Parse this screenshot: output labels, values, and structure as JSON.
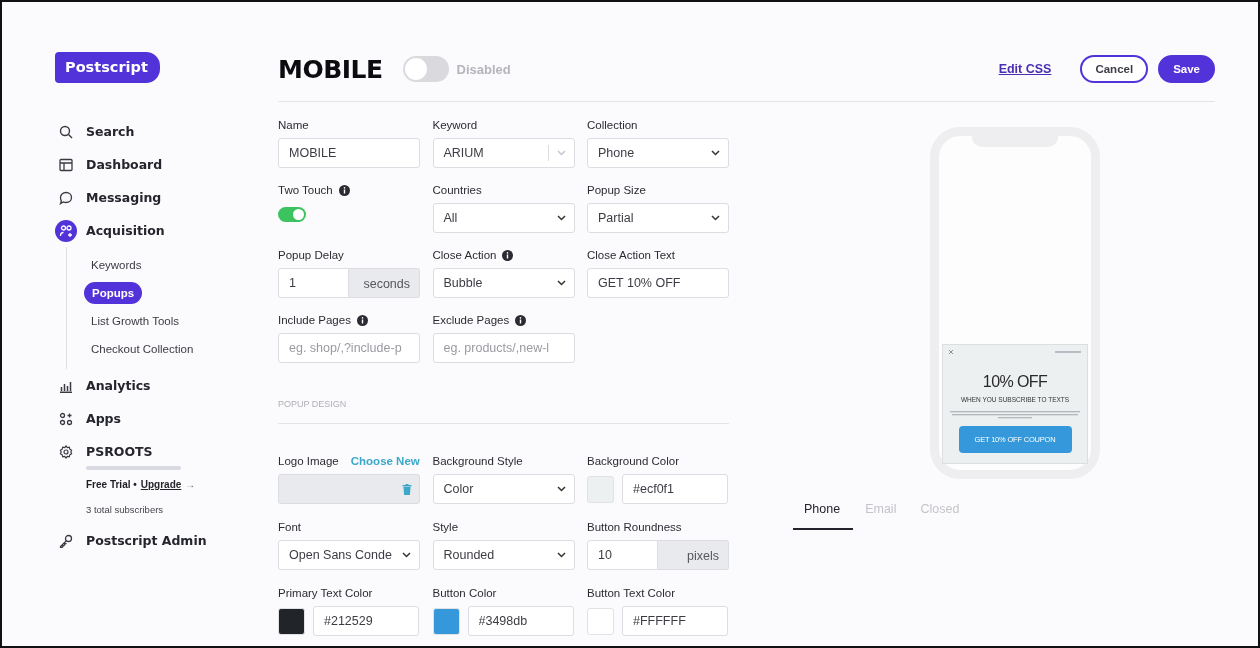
{
  "logo": "Postscript",
  "nav": [
    {
      "label": "Search",
      "selected": false
    },
    {
      "label": "Dashboard",
      "selected": false
    },
    {
      "label": "Messaging",
      "selected": false
    },
    {
      "label": "Acquisition",
      "selected": true,
      "children": [
        {
          "label": "Keywords",
          "selected": false
        },
        {
          "label": "Popups",
          "selected": true
        },
        {
          "label": "List Growth Tools",
          "selected": false
        },
        {
          "label": "Checkout Collection",
          "selected": false
        }
      ]
    },
    {
      "label": "Analytics",
      "selected": false
    },
    {
      "label": "Apps",
      "selected": false
    },
    {
      "label": "PSROOTS",
      "selected": false
    }
  ],
  "account": {
    "plan": "Free Trial •",
    "upgrade": "Upgrade",
    "arrow": "→",
    "subscribers": "3 total subscribers"
  },
  "admin": "Postscript Admin",
  "header": {
    "title": "MOBILE",
    "enabled": false,
    "status": "Disabled",
    "edit_css": "Edit CSS",
    "buttons": [
      {
        "label": "Cancel",
        "kind": "secondary"
      },
      {
        "label": "Save",
        "kind": "primary"
      }
    ]
  },
  "general": [
    {
      "label": "Name",
      "kind": "text",
      "value": "MOBILE"
    },
    {
      "label": "Keyword",
      "kind": "combo",
      "value": "ARIUM"
    },
    {
      "label": "Collection",
      "kind": "select",
      "value": "Phone"
    },
    {
      "label": "Two Touch",
      "info": true,
      "kind": "toggle",
      "on": true
    },
    {
      "label": "Countries",
      "kind": "select",
      "value": "All"
    },
    {
      "label": "Popup Size",
      "kind": "select",
      "value": "Partial"
    },
    {
      "label": "Popup Delay",
      "kind": "unit",
      "value": "1",
      "unit": "seconds"
    },
    {
      "label": "Close Action",
      "info": true,
      "kind": "select",
      "value": "Bubble"
    },
    {
      "label": "Close Action Text",
      "kind": "text",
      "value": "GET 10% OFF"
    },
    {
      "label": "Include Pages",
      "info": true,
      "kind": "text",
      "placeholder": "eg. shop/,?include-p"
    },
    {
      "label": "Exclude Pages",
      "info": true,
      "kind": "text",
      "placeholder": "eg. products/,new-l"
    }
  ],
  "design_title": "POPUP DESIGN",
  "design": [
    {
      "label": "Logo Image",
      "link": "Choose New",
      "kind": "logo"
    },
    {
      "label": "Background Style",
      "kind": "select",
      "value": "Color"
    },
    {
      "label": "Background Color",
      "kind": "color",
      "color": "#ecf0f1",
      "value": "#ecf0f1"
    },
    {
      "label": "Font",
      "kind": "select",
      "value": "Open Sans Conde"
    },
    {
      "label": "Style",
      "kind": "select",
      "value": "Rounded"
    },
    {
      "label": "Button Roundness",
      "kind": "unit",
      "value": "10",
      "unit": "pixels"
    },
    {
      "label": "Primary Text Color",
      "kind": "color",
      "color": "#212529",
      "value": "#212529"
    },
    {
      "label": "Button Color",
      "kind": "color",
      "color": "#3498db",
      "value": "#3498db"
    },
    {
      "label": "Button Text Color",
      "kind": "color",
      "color": "#ffffff",
      "value": "#FFFFFF"
    }
  ],
  "preview": {
    "headline": "10% OFF",
    "subhead": "WHEN YOU SUBSCRIBE TO TEXTS",
    "button": "GET 10% OFF COUPON"
  },
  "preview_tabs": [
    {
      "label": "Phone",
      "selected": true
    },
    {
      "label": "Email",
      "selected": false
    },
    {
      "label": "Closed",
      "selected": false
    }
  ]
}
